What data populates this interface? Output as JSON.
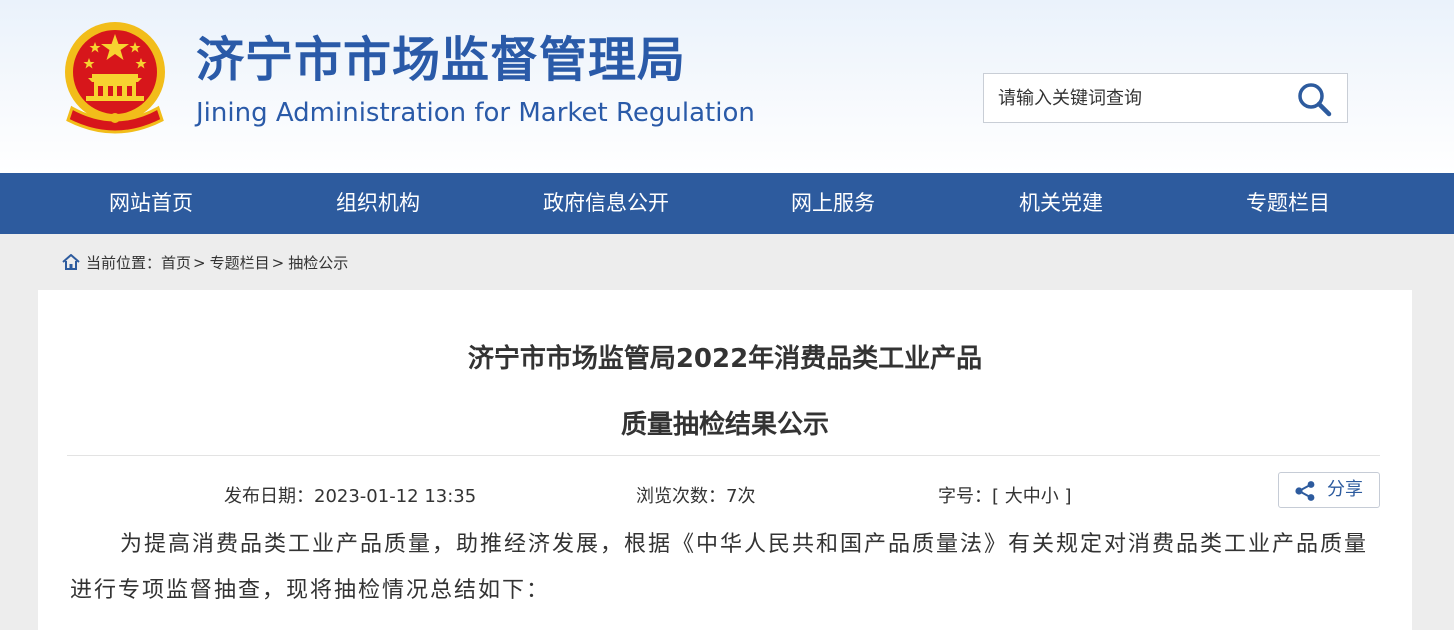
{
  "header": {
    "title_cn": "济宁市市场监督管理局",
    "title_en": "Jining Administration for Market Regulation",
    "emblem_icon": "national-emblem-icon",
    "search": {
      "placeholder": "请输入关键词查询",
      "icon": "search-icon"
    }
  },
  "nav": {
    "items": [
      {
        "label": "网站首页"
      },
      {
        "label": "组织机构"
      },
      {
        "label": "政府信息公开"
      },
      {
        "label": "网上服务"
      },
      {
        "label": "机关党建"
      },
      {
        "label": "专题栏目"
      }
    ]
  },
  "breadcrumb": {
    "prefix": "当前位置：",
    "items": [
      "首页",
      "专题栏目",
      "抽检公示"
    ],
    "separator": ">"
  },
  "article": {
    "title_line1": "济宁市市场监管局2022年消费品类工业产品",
    "title_line2": "质量抽检结果公示",
    "date_label": "发布日期：",
    "date_value": "2023-01-12 13:35",
    "views_label": "浏览次数：",
    "views_value": "7次",
    "font_label": "字号：",
    "font_open": "[ ",
    "font_large": "大",
    "font_medium": "中",
    "font_small": "小",
    "font_close": " ]",
    "share_label": "分享",
    "share_icon": "share-icon",
    "paragraph": "为提高消费品类工业产品质量，助推经济发展，根据《中华人民共和国产品质量法》有关规定对消费品类工业产品质量进行专项监督抽查，现将抽检情况总结如下："
  },
  "colors": {
    "brand_blue": "#2d5b9e",
    "title_blue": "#2a5aa8",
    "page_bg": "#ededed",
    "emblem_red": "#d7161b",
    "emblem_gold": "#f3c200"
  }
}
